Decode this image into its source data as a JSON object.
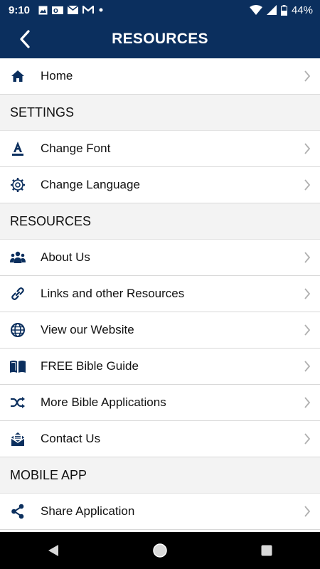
{
  "status": {
    "time": "9:10",
    "notification_icons": [
      "image-icon",
      "outlook-icon",
      "mail-icon",
      "gmail-icon",
      "dot-icon"
    ],
    "battery_percent": "44%"
  },
  "appbar": {
    "title": "RESOURCES"
  },
  "items": {
    "home": "Home",
    "section_settings": "SETTINGS",
    "change_font": "Change Font",
    "change_language": "Change Language",
    "section_resources": "RESOURCES",
    "about_us": "About Us",
    "links": "Links and other Resources",
    "website": "View our Website",
    "bible_guide": "FREE Bible Guide",
    "more_apps": "More Bible Applications",
    "contact": "Contact Us",
    "section_mobile": "MOBILE APP",
    "share": "Share Application"
  },
  "colors": {
    "primary": "#0b2f5e",
    "icon": "#0b2f5e",
    "section_bg": "#f3f3f3",
    "chevron": "#b0b0b0"
  }
}
